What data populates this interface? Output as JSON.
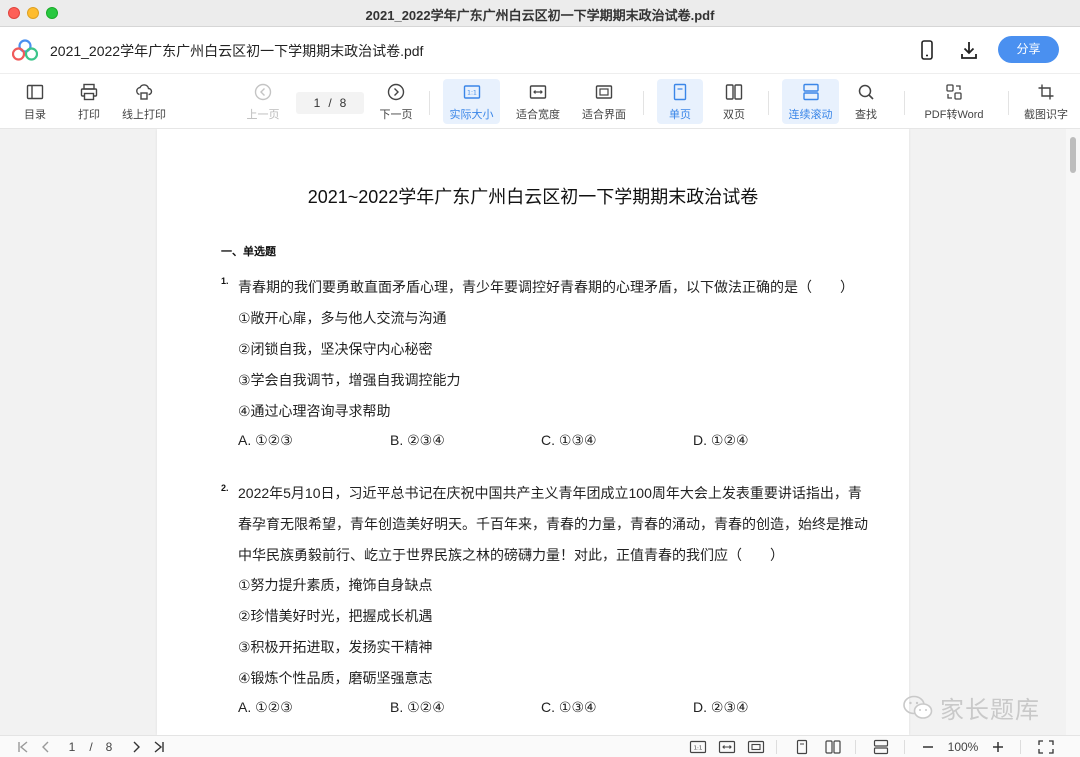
{
  "window": {
    "title": "2021_2022学年广东广州白云区初一下学期期末政治试卷.pdf"
  },
  "header": {
    "doc_title": "2021_2022学年广东广州白云区初一下学期期末政治试卷.pdf",
    "share_label": "分享"
  },
  "toolbar": {
    "toc": "目录",
    "print": "打印",
    "online_print": "线上打印",
    "prev": "上一页",
    "current_page": "1",
    "page_sep": "/",
    "total_pages": "8",
    "next": "下一页",
    "actual_size": "实际大小",
    "fit_width": "适合宽度",
    "fit_screen": "适合界面",
    "single_page": "单页",
    "double_page": "双页",
    "continuous": "连续滚动",
    "search": "查找",
    "pdf_to_word": "PDF转Word",
    "ocr": "截图识字"
  },
  "document": {
    "title": "2021~2022学年广东广州白云区初一下学期期末政治试卷",
    "section": "一、单选题",
    "questions": [
      {
        "number": "1.",
        "stem": [
          "青春期的我们要勇敢直面矛盾心理，青少年要调控好青春期的心理矛盾，以下做法正确的是（　　）"
        ],
        "options": [
          "①敞开心扉，多与他人交流与沟通",
          "②闭锁自我，坚决保守内心秘密",
          "③学会自我调节，增强自我调控能力",
          "④通过心理咨询寻求帮助"
        ],
        "choices": [
          "A. ①②③",
          "B. ②③④",
          "C. ①③④",
          "D. ①②④"
        ]
      },
      {
        "number": "2.",
        "stem": [
          "2022年5月10日，习近平总书记在庆祝中国共产主义青年团成立100周年大会上发表重要讲话指出，青",
          "春孕育无限希望，青年创造美好明天。千百年来，青春的力量，青春的涌动，青春的创造，始终是推动",
          "中华民族勇毅前行、屹立于世界民族之林的磅礴力量！对此，正值青春的我们应（　　）"
        ],
        "options": [
          "①努力提升素质，掩饰自身缺点",
          "②珍惜美好时光，把握成长机遇",
          "③积极开拓进取，发扬实干精神",
          "④锻炼个性品质，磨砺坚强意志"
        ],
        "choices": [
          "A. ①②③",
          "B. ①②④",
          "C. ①③④",
          "D. ②③④"
        ]
      }
    ]
  },
  "watermark": {
    "text": "家长题库"
  },
  "statusbar": {
    "current_page": "1",
    "page_sep": "/",
    "total_pages": "8",
    "zoom": "100%"
  },
  "colors": {
    "accent": "#4a90f0",
    "active_bg": "#e8f1fd",
    "active_text": "#3a86e8"
  }
}
